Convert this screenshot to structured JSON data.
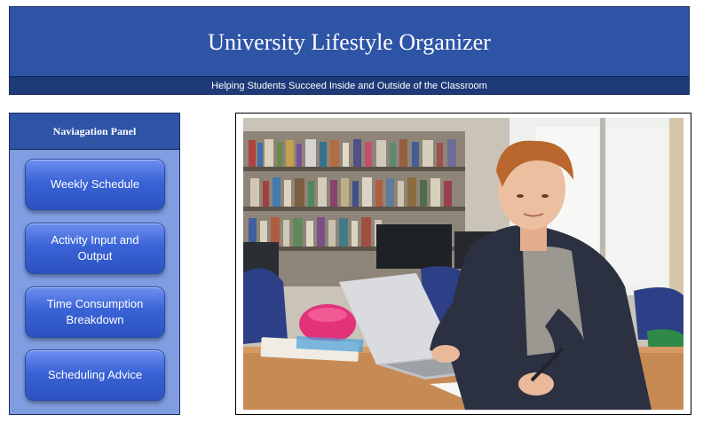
{
  "header": {
    "title": "University Lifestyle Organizer",
    "subtitle": "Helping Students Succeed Inside and Outside of the Classroom"
  },
  "nav": {
    "title": "Naviagation Panel",
    "items": [
      {
        "label": "Weekly Schedule"
      },
      {
        "label": "Activity Input and Output"
      },
      {
        "label": "Time Consumption Breakdown"
      },
      {
        "label": "Scheduling Advice"
      }
    ]
  },
  "colors": {
    "header_bg": "#2e54a6",
    "subtitle_bg": "#1f3a78",
    "nav_bg": "#7f9de0",
    "button": "#3a63d6"
  },
  "photo": {
    "depicts": "student-studying-with-laptop-in-library-photo"
  }
}
